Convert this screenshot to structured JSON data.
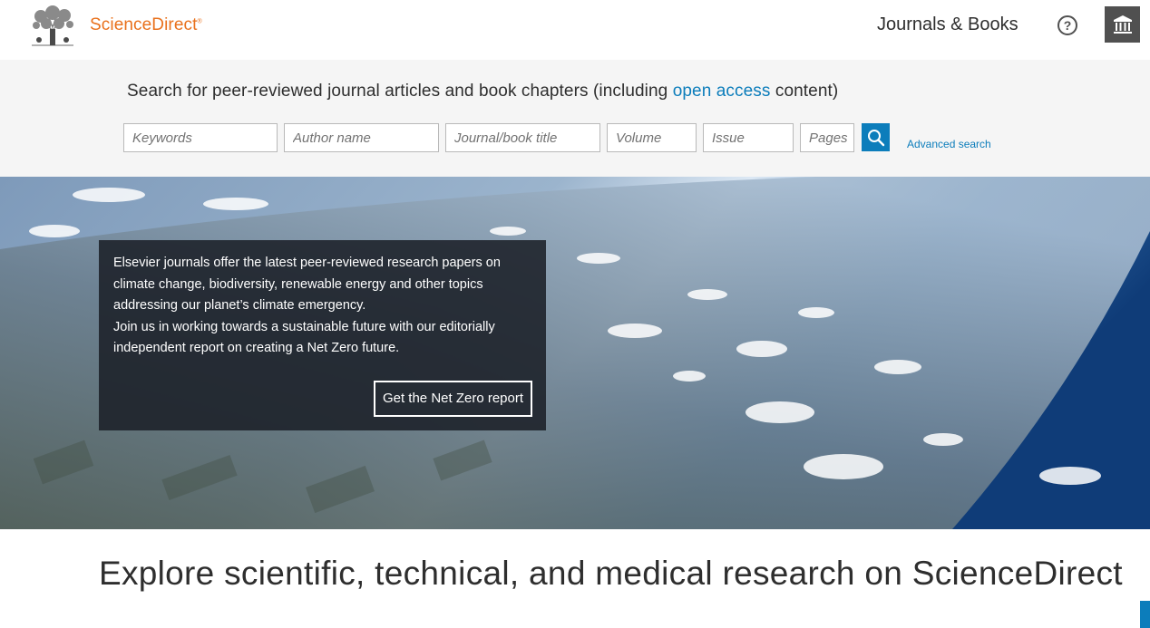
{
  "header": {
    "brand": "ScienceDirect",
    "brand_mark": "®",
    "nav_journals": "Journals & Books",
    "help_icon": "question-circle-icon",
    "help_glyph": "?",
    "institution_icon": "institution-icon"
  },
  "search": {
    "intro_before": "Search for peer-reviewed journal articles and book chapters (including ",
    "intro_link": "open access",
    "intro_after": " content)",
    "keywords_placeholder": "Keywords",
    "author_placeholder": "Author name",
    "journal_placeholder": "Journal/book title",
    "volume_placeholder": "Volume",
    "issue_placeholder": "Issue",
    "pages_placeholder": "Pages",
    "search_icon": "search-icon",
    "advanced_label": "Advanced search"
  },
  "hero": {
    "line1": "Elsevier journals offer the latest peer-reviewed research papers on climate change, biodiversity, renewable energy and other topics addressing our planet’s climate emergency.",
    "line2": "Join us in working towards a sustainable future with our editorially independent report on creating a Net Zero future.",
    "cta": "Get the Net Zero report"
  },
  "explore": {
    "title": "Explore scientific, technical, and medical research on ScienceDirect"
  },
  "colors": {
    "brand_orange": "#e9711c",
    "link_blue": "#0c7dbb",
    "search_band": "#f5f5f5",
    "dark_gray": "#505050"
  }
}
